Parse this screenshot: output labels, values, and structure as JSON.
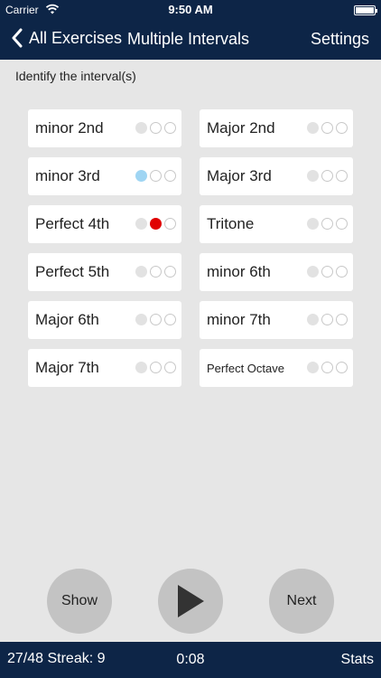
{
  "status_bar": {
    "carrier": "Carrier",
    "time": "9:50 AM"
  },
  "nav": {
    "back_label": "All Exercises",
    "title": "Multiple Intervals",
    "settings_label": "Settings"
  },
  "prompt": "Identify the interval(s)",
  "intervals": [
    {
      "label": "minor 2nd",
      "dots": [
        "grey",
        "empty",
        "empty"
      ]
    },
    {
      "label": "Major 2nd",
      "dots": [
        "grey",
        "empty",
        "empty"
      ]
    },
    {
      "label": "minor 3rd",
      "dots": [
        "blue",
        "empty",
        "empty"
      ]
    },
    {
      "label": "Major 3rd",
      "dots": [
        "grey",
        "empty",
        "empty"
      ]
    },
    {
      "label": "Perfect 4th",
      "dots": [
        "grey",
        "red",
        "empty"
      ]
    },
    {
      "label": "Tritone",
      "dots": [
        "grey",
        "empty",
        "empty"
      ]
    },
    {
      "label": "Perfect 5th",
      "dots": [
        "grey",
        "empty",
        "empty"
      ]
    },
    {
      "label": "minor 6th",
      "dots": [
        "grey",
        "empty",
        "empty"
      ]
    },
    {
      "label": "Major 6th",
      "dots": [
        "grey",
        "empty",
        "empty"
      ]
    },
    {
      "label": "minor 7th",
      "dots": [
        "grey",
        "empty",
        "empty"
      ]
    },
    {
      "label": "Major 7th",
      "dots": [
        "grey",
        "empty",
        "empty"
      ]
    },
    {
      "label": "Perfect Octave",
      "dots": [
        "grey",
        "empty",
        "empty"
      ]
    }
  ],
  "controls": {
    "show_label": "Show",
    "play_icon": "play-icon",
    "next_label": "Next"
  },
  "footer": {
    "score": "27/48 Streak: 9",
    "timer": "0:08",
    "stats_label": "Stats"
  },
  "colors": {
    "navy": "#0d2547",
    "background": "#e6e6e6",
    "blue_dot": "#9fd5f3",
    "red_dot": "#e00000",
    "button_grey": "#c3c3c3"
  }
}
